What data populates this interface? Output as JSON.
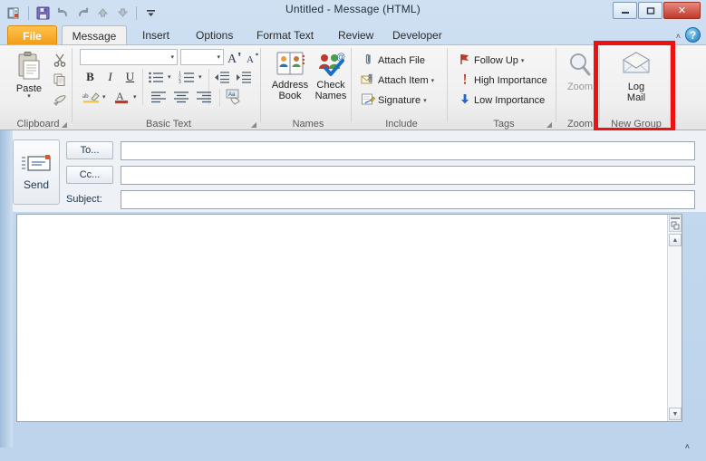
{
  "window": {
    "title": "Untitled  -  Message (HTML)",
    "controls": {
      "minimize": "—",
      "maximize": "□",
      "close": "✕"
    }
  },
  "quick_access": {
    "items": [
      {
        "name": "outlook-icon",
        "glyph": "✉"
      },
      {
        "name": "save-icon",
        "glyph": "💾"
      },
      {
        "name": "undo-icon",
        "glyph": "↶"
      },
      {
        "name": "redo-icon",
        "glyph": "↷"
      },
      {
        "name": "previous-item-icon",
        "glyph": "▲"
      },
      {
        "name": "next-item-icon",
        "glyph": "▼"
      },
      {
        "name": "customize-qat-icon",
        "glyph": "▾"
      }
    ]
  },
  "tabs": [
    {
      "label": "File",
      "active": false
    },
    {
      "label": "Message",
      "active": true
    },
    {
      "label": "Insert",
      "active": false
    },
    {
      "label": "Options",
      "active": false
    },
    {
      "label": "Format Text",
      "active": false
    },
    {
      "label": "Review",
      "active": false
    },
    {
      "label": "Developer",
      "active": false
    }
  ],
  "help_button": "?",
  "ribbon_collapse": "˄",
  "ribbon": {
    "clipboard": {
      "label": "Clipboard",
      "paste_label": "Paste",
      "paste_caret": "▾",
      "cut_label": "Cut",
      "copy_label": "Copy",
      "format_painter_label": "Format Painter",
      "dialog_launcher": "◢"
    },
    "basic_text": {
      "label": "Basic Text",
      "font_name_value": "",
      "font_size_value": "",
      "grow_font": "A",
      "shrink_font": "A",
      "bold": "B",
      "italic": "I",
      "underline": "U",
      "bullets": "☰",
      "numbering": "☰",
      "decrease_indent": "⇤",
      "increase_indent": "⇥",
      "highlight": "ab",
      "font_color": "A",
      "align_left": "☰",
      "align_center": "☰",
      "align_right": "☰",
      "clear_formatting": "Aa",
      "dialog_launcher": "◢"
    },
    "names": {
      "label": "Names",
      "address_book_line1": "Address",
      "address_book_line2": "Book",
      "check_names_line1": "Check",
      "check_names_line2": "Names"
    },
    "include": {
      "label": "Include",
      "attach_file": "Attach File",
      "attach_item": "Attach Item",
      "signature": "Signature",
      "caret": "▾"
    },
    "tags": {
      "label": "Tags",
      "follow_up": "Follow Up",
      "high_importance": "High Importance",
      "low_importance": "Low Importance",
      "caret": "▾",
      "dialog_launcher": "◢"
    },
    "zoom": {
      "label": "Zoom",
      "button_label": "Zoom"
    },
    "new_group": {
      "label": "New Group",
      "log_mail_line1": "Log",
      "log_mail_line2": "Mail"
    }
  },
  "annotation": {
    "color": "#ee1111",
    "target": "Log Mail button in New Group"
  },
  "message_header": {
    "send_label": "Send",
    "to_label": "To...",
    "cc_label": "Cc...",
    "subject_label": "Subject:",
    "to_value": "",
    "cc_value": "",
    "subject_value": ""
  },
  "message_body": {
    "value": ""
  },
  "scrollbar": {
    "up_arrow": "▲",
    "down_arrow": "▼"
  },
  "status_bar": {
    "caret": "˄"
  }
}
